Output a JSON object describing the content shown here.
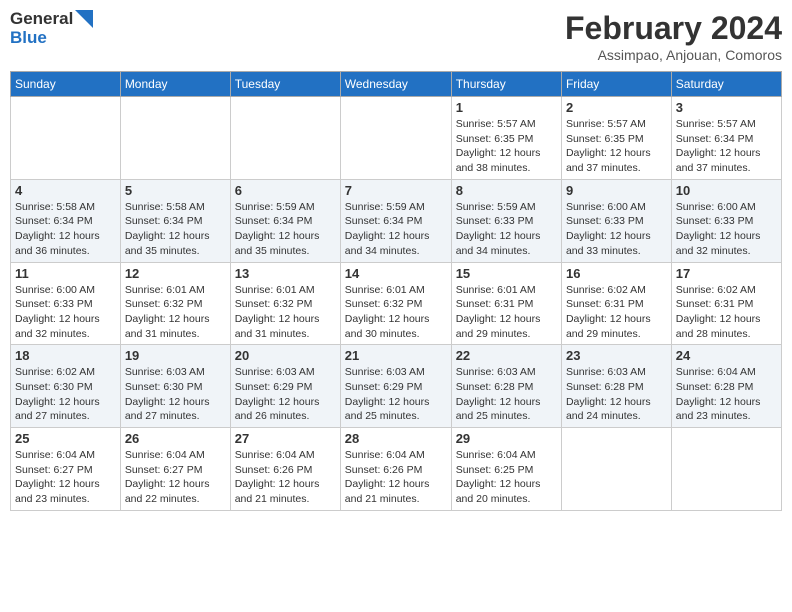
{
  "logo": {
    "line1": "General",
    "line2": "Blue"
  },
  "title": "February 2024",
  "subtitle": "Assimpao, Anjouan, Comoros",
  "days_of_week": [
    "Sunday",
    "Monday",
    "Tuesday",
    "Wednesday",
    "Thursday",
    "Friday",
    "Saturday"
  ],
  "weeks": [
    [
      {
        "num": "",
        "info": ""
      },
      {
        "num": "",
        "info": ""
      },
      {
        "num": "",
        "info": ""
      },
      {
        "num": "",
        "info": ""
      },
      {
        "num": "1",
        "info": "Sunrise: 5:57 AM\nSunset: 6:35 PM\nDaylight: 12 hours\nand 38 minutes."
      },
      {
        "num": "2",
        "info": "Sunrise: 5:57 AM\nSunset: 6:35 PM\nDaylight: 12 hours\nand 37 minutes."
      },
      {
        "num": "3",
        "info": "Sunrise: 5:57 AM\nSunset: 6:34 PM\nDaylight: 12 hours\nand 37 minutes."
      }
    ],
    [
      {
        "num": "4",
        "info": "Sunrise: 5:58 AM\nSunset: 6:34 PM\nDaylight: 12 hours\nand 36 minutes."
      },
      {
        "num": "5",
        "info": "Sunrise: 5:58 AM\nSunset: 6:34 PM\nDaylight: 12 hours\nand 35 minutes."
      },
      {
        "num": "6",
        "info": "Sunrise: 5:59 AM\nSunset: 6:34 PM\nDaylight: 12 hours\nand 35 minutes."
      },
      {
        "num": "7",
        "info": "Sunrise: 5:59 AM\nSunset: 6:34 PM\nDaylight: 12 hours\nand 34 minutes."
      },
      {
        "num": "8",
        "info": "Sunrise: 5:59 AM\nSunset: 6:33 PM\nDaylight: 12 hours\nand 34 minutes."
      },
      {
        "num": "9",
        "info": "Sunrise: 6:00 AM\nSunset: 6:33 PM\nDaylight: 12 hours\nand 33 minutes."
      },
      {
        "num": "10",
        "info": "Sunrise: 6:00 AM\nSunset: 6:33 PM\nDaylight: 12 hours\nand 32 minutes."
      }
    ],
    [
      {
        "num": "11",
        "info": "Sunrise: 6:00 AM\nSunset: 6:33 PM\nDaylight: 12 hours\nand 32 minutes."
      },
      {
        "num": "12",
        "info": "Sunrise: 6:01 AM\nSunset: 6:32 PM\nDaylight: 12 hours\nand 31 minutes."
      },
      {
        "num": "13",
        "info": "Sunrise: 6:01 AM\nSunset: 6:32 PM\nDaylight: 12 hours\nand 31 minutes."
      },
      {
        "num": "14",
        "info": "Sunrise: 6:01 AM\nSunset: 6:32 PM\nDaylight: 12 hours\nand 30 minutes."
      },
      {
        "num": "15",
        "info": "Sunrise: 6:01 AM\nSunset: 6:31 PM\nDaylight: 12 hours\nand 29 minutes."
      },
      {
        "num": "16",
        "info": "Sunrise: 6:02 AM\nSunset: 6:31 PM\nDaylight: 12 hours\nand 29 minutes."
      },
      {
        "num": "17",
        "info": "Sunrise: 6:02 AM\nSunset: 6:31 PM\nDaylight: 12 hours\nand 28 minutes."
      }
    ],
    [
      {
        "num": "18",
        "info": "Sunrise: 6:02 AM\nSunset: 6:30 PM\nDaylight: 12 hours\nand 27 minutes."
      },
      {
        "num": "19",
        "info": "Sunrise: 6:03 AM\nSunset: 6:30 PM\nDaylight: 12 hours\nand 27 minutes."
      },
      {
        "num": "20",
        "info": "Sunrise: 6:03 AM\nSunset: 6:29 PM\nDaylight: 12 hours\nand 26 minutes."
      },
      {
        "num": "21",
        "info": "Sunrise: 6:03 AM\nSunset: 6:29 PM\nDaylight: 12 hours\nand 25 minutes."
      },
      {
        "num": "22",
        "info": "Sunrise: 6:03 AM\nSunset: 6:28 PM\nDaylight: 12 hours\nand 25 minutes."
      },
      {
        "num": "23",
        "info": "Sunrise: 6:03 AM\nSunset: 6:28 PM\nDaylight: 12 hours\nand 24 minutes."
      },
      {
        "num": "24",
        "info": "Sunrise: 6:04 AM\nSunset: 6:28 PM\nDaylight: 12 hours\nand 23 minutes."
      }
    ],
    [
      {
        "num": "25",
        "info": "Sunrise: 6:04 AM\nSunset: 6:27 PM\nDaylight: 12 hours\nand 23 minutes."
      },
      {
        "num": "26",
        "info": "Sunrise: 6:04 AM\nSunset: 6:27 PM\nDaylight: 12 hours\nand 22 minutes."
      },
      {
        "num": "27",
        "info": "Sunrise: 6:04 AM\nSunset: 6:26 PM\nDaylight: 12 hours\nand 21 minutes."
      },
      {
        "num": "28",
        "info": "Sunrise: 6:04 AM\nSunset: 6:26 PM\nDaylight: 12 hours\nand 21 minutes."
      },
      {
        "num": "29",
        "info": "Sunrise: 6:04 AM\nSunset: 6:25 PM\nDaylight: 12 hours\nand 20 minutes."
      },
      {
        "num": "",
        "info": ""
      },
      {
        "num": "",
        "info": ""
      }
    ]
  ]
}
